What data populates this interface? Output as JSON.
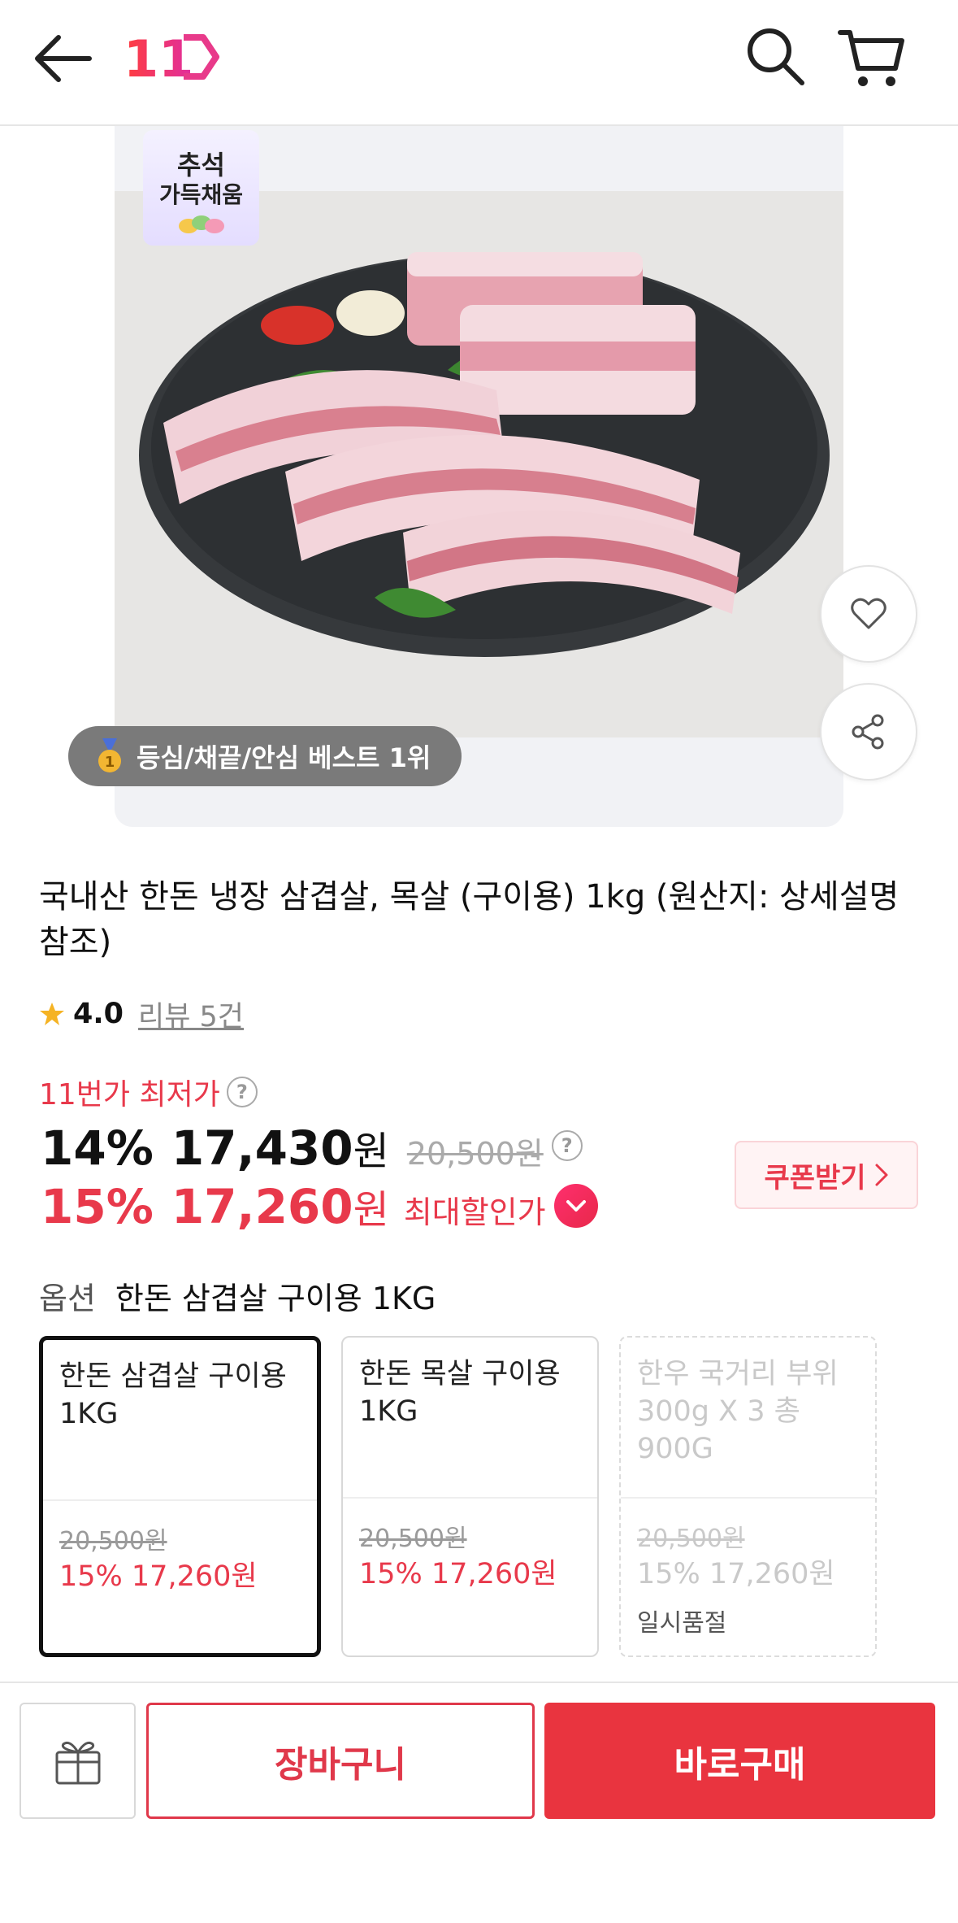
{
  "header": {
    "back_icon": "arrow-left-icon",
    "logo_text": "11",
    "search_icon": "search-icon",
    "cart_icon": "cart-icon"
  },
  "product_image": {
    "promo_sticker": {
      "line1": "추석",
      "line2": "가득채움"
    },
    "rank_badge": "등심/채끝/안심 베스트 1위",
    "rank_icon": "medal-icon",
    "like_icon": "heart-icon",
    "share_icon": "share-icon"
  },
  "product": {
    "title": "국내산 한돈 냉장 삼겹살, 목살 (구이용) 1kg (원산지: 상세설명 참조)",
    "rating": "4.0",
    "reviews_label": "리뷰 5건"
  },
  "pricing": {
    "lowest_label": "11번가 최저가",
    "help_mark": "?",
    "price1": {
      "discount": "14%",
      "amount": "17,430",
      "unit": "원",
      "original": "20,500원"
    },
    "price2": {
      "discount": "15%",
      "amount": "17,260",
      "unit": "원",
      "label": "최대할인가"
    },
    "coupon_label": "쿠폰받기"
  },
  "options": {
    "label": "옵션",
    "selected_value": "한돈 삼겹살 구이용 1KG",
    "items": [
      {
        "name": "한돈 삼겹살 구이용 1KG",
        "original": "20,500원",
        "sale": "15% 17,260원",
        "status": ""
      },
      {
        "name": "한돈 목살 구이용 1KG",
        "original": "20,500원",
        "sale": "15% 17,260원",
        "status": ""
      },
      {
        "name": "한우 국거리 부위 300g X 3 총 900G",
        "original": "20,500원",
        "sale": "15% 17,260원",
        "status": "일시품절"
      }
    ]
  },
  "bottom_bar": {
    "gift_icon": "gift-icon",
    "cart_button": "장바구니",
    "buy_button": "바로구매"
  },
  "colors": {
    "accent": "#e8394b",
    "buy_button": "#e9343f",
    "badge_bg": "#7a7a7a"
  }
}
